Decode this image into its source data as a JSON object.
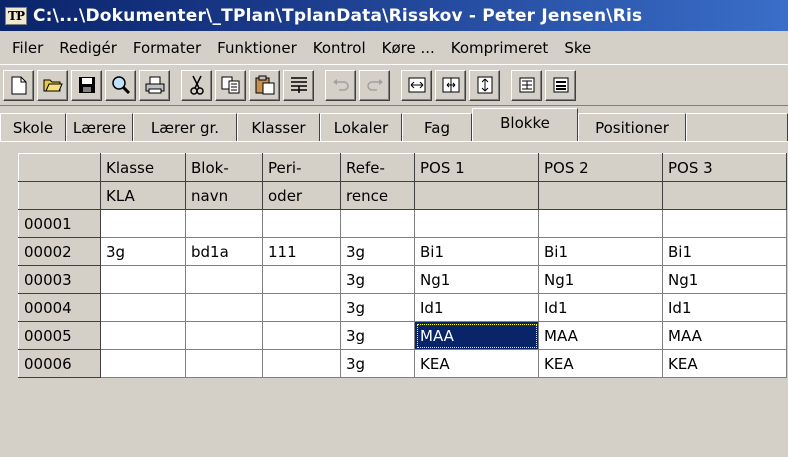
{
  "window": {
    "icon_text": "TP",
    "title": "C:\\...\\Dokumenter\\_TPlan\\TplanData\\Risskov - Peter Jensen\\Ris"
  },
  "menu": [
    "Filer",
    "Redigér",
    "Formater",
    "Funktioner",
    "Kontrol",
    "Køre ...",
    "Komprimeret",
    "Ske"
  ],
  "toolbar": {
    "buttons": [
      "new-file-icon",
      "open-folder-icon",
      "save-icon",
      "search-icon",
      "print-icon",
      "cut-icon",
      "copy-icon",
      "paste-icon",
      "align-icon",
      "undo-icon",
      "redo-icon",
      "fit-width-icon",
      "expand-width-icon",
      "expand-height-icon",
      "align-center-icon",
      "align-bottom-icon"
    ]
  },
  "tabs": [
    {
      "label": "Skole"
    },
    {
      "label": "Lærere"
    },
    {
      "label": "Lærer gr."
    },
    {
      "label": "Klasser"
    },
    {
      "label": "Lokaler"
    },
    {
      "label": "Fag"
    },
    {
      "label": "Blokke",
      "active": true
    },
    {
      "label": "Positioner"
    }
  ],
  "grid": {
    "header_row_1": [
      "",
      "Klasse",
      "Blok-",
      "Peri-",
      "Refe-",
      "POS 1",
      "POS 2",
      "POS 3"
    ],
    "header_row_2": [
      "",
      "KLA",
      "navn",
      "oder",
      "rence",
      "",
      "",
      ""
    ],
    "rows": [
      {
        "id": "00001",
        "cells": [
          "",
          "",
          "",
          "",
          "",
          "",
          ""
        ]
      },
      {
        "id": "00002",
        "cells": [
          "3g",
          "bd1a",
          "111",
          "3g",
          "Bi1",
          "Bi1",
          "Bi1"
        ]
      },
      {
        "id": "00003",
        "cells": [
          "",
          "",
          "",
          "3g",
          "Ng1",
          "Ng1",
          "Ng1"
        ]
      },
      {
        "id": "00004",
        "cells": [
          "",
          "",
          "",
          "3g",
          "Id1",
          "Id1",
          "Id1"
        ]
      },
      {
        "id": "00005",
        "cells": [
          "",
          "",
          "",
          "3g",
          "MAA",
          "MAA",
          "MAA"
        ]
      },
      {
        "id": "00006",
        "cells": [
          "",
          "",
          "",
          "3g",
          "KEA",
          "KEA",
          "KEA"
        ]
      }
    ],
    "selected": {
      "row": 4,
      "col": 4
    }
  },
  "colors": {
    "title_bar": "#0a246a",
    "selection": "#0a246a",
    "face": "#d4d0c8"
  }
}
